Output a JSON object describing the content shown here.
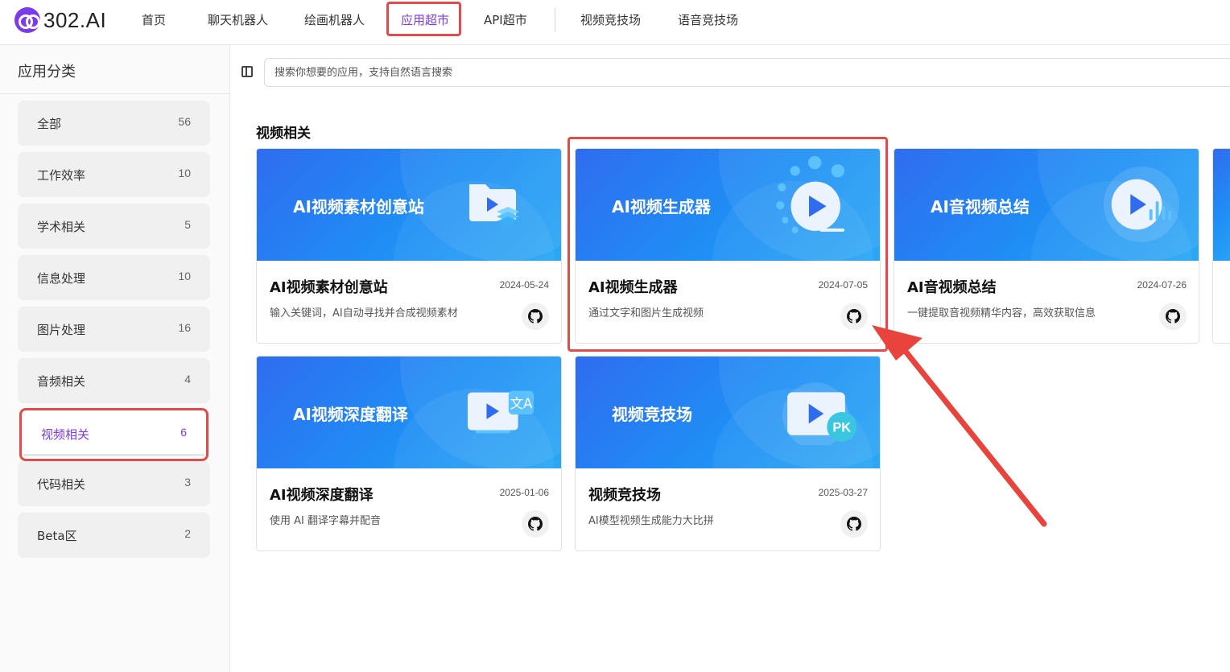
{
  "brand": {
    "logo_text": "302.AI"
  },
  "nav": {
    "items": [
      {
        "label": "首页"
      },
      {
        "label": "聊天机器人"
      },
      {
        "label": "绘画机器人"
      },
      {
        "label": "应用超市"
      },
      {
        "label": "API超市"
      },
      {
        "label": "视频竞技场"
      },
      {
        "label": "语音竞技场"
      }
    ],
    "active": "应用超市"
  },
  "sidebar": {
    "title": "应用分类",
    "categories": [
      {
        "label": "全部",
        "count": "56"
      },
      {
        "label": "工作效率",
        "count": "10"
      },
      {
        "label": "学术相关",
        "count": "5"
      },
      {
        "label": "信息处理",
        "count": "10"
      },
      {
        "label": "图片处理",
        "count": "16"
      },
      {
        "label": "音频相关",
        "count": "4"
      },
      {
        "label": "视频相关",
        "count": "6"
      },
      {
        "label": "代码相关",
        "count": "3"
      },
      {
        "label": "Beta区",
        "count": "2"
      }
    ],
    "active": "视频相关"
  },
  "search": {
    "placeholder": "搜索你想要的应用，支持自然语言搜索",
    "value": ""
  },
  "section": {
    "title": "视频相关",
    "cards": [
      {
        "banner_title": "AI视频素材创意站",
        "title": "AI视频素材创意站",
        "date": "2024-05-24",
        "desc": "输入关键词，AI自动寻找并合成视频素材",
        "icon": "folder-play-icon"
      },
      {
        "banner_title": "AI视频生成器",
        "title": "AI视频生成器",
        "date": "2024-07-05",
        "desc": "通过文字和图片生成视频",
        "icon": "play-loading-icon"
      },
      {
        "banner_title": "AI音视频总结",
        "title": "AI音视频总结",
        "date": "2024-07-26",
        "desc": "一键提取音视频精华内容，高效获取信息",
        "icon": "play-audio-icon"
      },
      {
        "banner_title": "AI视频深度翻译",
        "title": "AI视频深度翻译",
        "date": "2025-01-06",
        "desc": "使用 AI 翻译字幕并配音",
        "icon": "video-translate-icon"
      },
      {
        "banner_title": "视频竞技场",
        "title": "视频竞技场",
        "date": "2025-03-27",
        "desc": "AI模型视频生成能力大比拼",
        "icon": "video-pk-icon"
      }
    ]
  },
  "colors": {
    "accent": "#7c3aed",
    "highlight": "#e24b4b",
    "banner_blue": "#2f6cf0"
  }
}
